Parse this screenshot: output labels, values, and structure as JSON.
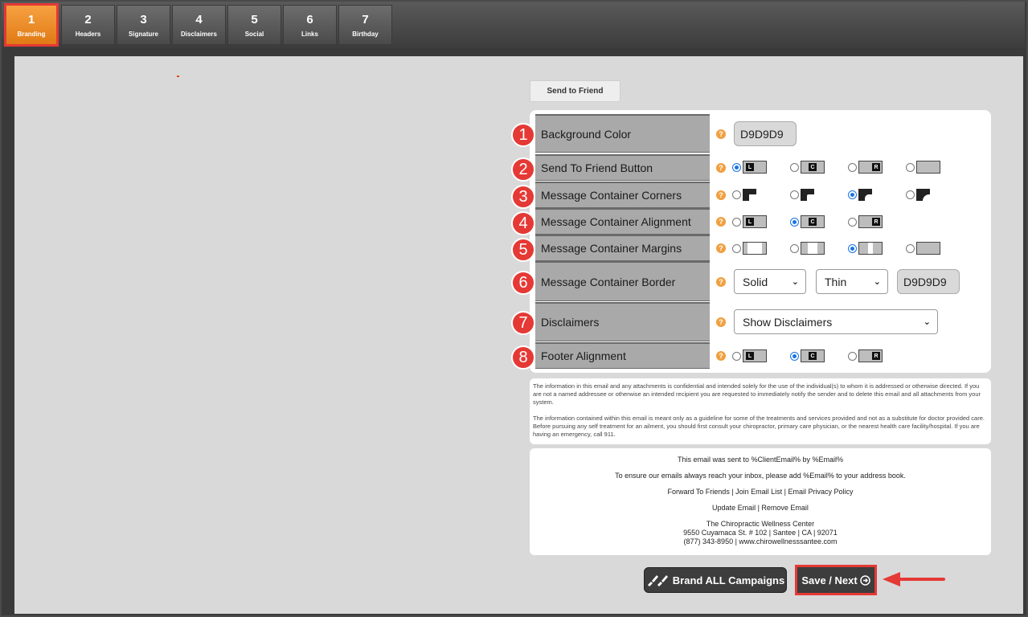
{
  "tabs": [
    {
      "num": "1",
      "label": "Branding"
    },
    {
      "num": "2",
      "label": "Headers"
    },
    {
      "num": "3",
      "label": "Signature"
    },
    {
      "num": "4",
      "label": "Disclaimers"
    },
    {
      "num": "5",
      "label": "Social"
    },
    {
      "num": "6",
      "label": "Links"
    },
    {
      "num": "7",
      "label": "Birthday"
    }
  ],
  "send_to_friend_label": "Send to Friend",
  "rows": [
    {
      "badge": "1",
      "label": "Background Color",
      "value": "D9D9D9"
    },
    {
      "badge": "2",
      "label": "Send To Friend Button",
      "options": [
        "L",
        "C",
        "R",
        ""
      ],
      "selected": 0
    },
    {
      "badge": "3",
      "label": "Message Container Corners",
      "selected": 2
    },
    {
      "badge": "4",
      "label": "Message Container Alignment",
      "options": [
        "L",
        "C",
        "R"
      ],
      "selected": 1
    },
    {
      "badge": "5",
      "label": "Message Container Margins",
      "selected": 2
    },
    {
      "badge": "6",
      "label": "Message Container Border",
      "style": "Solid",
      "width": "Thin",
      "color": "D9D9D9"
    },
    {
      "badge": "7",
      "label": "Disclaimers",
      "value": "Show Disclaimers"
    },
    {
      "badge": "8",
      "label": "Footer Alignment",
      "options": [
        "L",
        "C",
        "R"
      ],
      "selected": 1
    }
  ],
  "help_glyph": "?",
  "chevron_glyph": "⌄",
  "disclaimer": {
    "p1": "The information in this email and any attachments is confidential and intended solely for the use of the individual(s) to whom it is addressed or otherwise directed. If you are not a named addressee or otherwise an intended recipient you are requested to immediately notify the sender and to delete this email and all attachments from your system.",
    "p2": "The information contained within this email is meant only as a guideline for some of the treatments and services provided and not as a substitute for doctor provided care. Before pursuing any self treatment for an ailment, you should first consult your chiropractor, primary care physician, or the nearest health care facility/hospital. If you are having an emergency, call 911."
  },
  "footer": {
    "sent_to": "This email was sent to %ClientEmail% by %Email%",
    "ensure": "To ensure our emails always reach your inbox, please add %Email% to your address book.",
    "links1": "Forward To Friends | Join Email List | Email Privacy Policy",
    "links2": "Update Email | Remove Email",
    "company": "The Chiropractic Wellness Center",
    "address": "9550 Cuyamaca St. # 102 | Santee | CA | 92071",
    "contact": "(877) 343-8950 | www.chirowellnesssantee.com"
  },
  "brand_all_label": "Brand ALL Campaigns",
  "brand_icon": "paint-brushes-icon",
  "save_next_label": "Save / Next",
  "save_icon": "arrow-circle-right-icon",
  "colors": {
    "accent_orange": "#f08a24",
    "highlight_red": "#e53935",
    "label_gray": "#a9a9a9",
    "radio_blue": "#1a73e8"
  }
}
